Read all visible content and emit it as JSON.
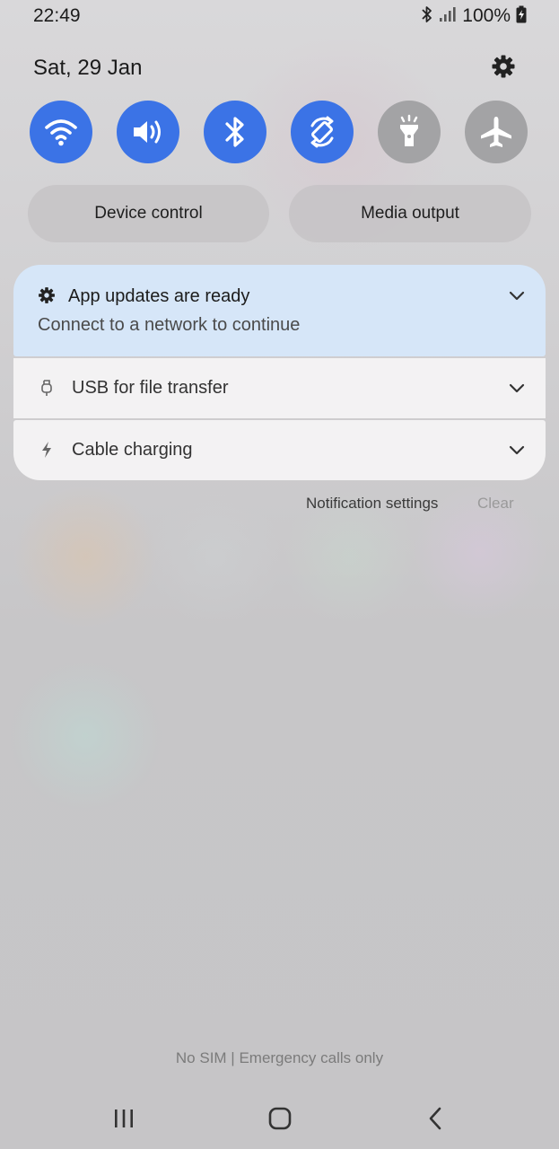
{
  "status_bar": {
    "time": "22:49",
    "battery_percent": "100%",
    "icons": [
      "bluetooth-icon",
      "signal-icon",
      "battery-charging-icon"
    ]
  },
  "panel": {
    "date": "Sat, 29 Jan",
    "settings_icon": "gear-icon"
  },
  "quick_settings": [
    {
      "name": "wifi",
      "icon": "wifi-icon",
      "state": "on"
    },
    {
      "name": "sound",
      "icon": "volume-icon",
      "state": "on"
    },
    {
      "name": "bluetooth",
      "icon": "bluetooth-icon",
      "state": "on"
    },
    {
      "name": "auto-rotate",
      "icon": "rotate-icon",
      "state": "on"
    },
    {
      "name": "flashlight",
      "icon": "flashlight-icon",
      "state": "off"
    },
    {
      "name": "airplane-mode",
      "icon": "airplane-icon",
      "state": "off"
    }
  ],
  "buttons": {
    "device_control": "Device control",
    "media_output": "Media output"
  },
  "notifications": {
    "app_updates": {
      "title": "App updates are ready",
      "body": "Connect to a network to continue",
      "icon": "gear-icon"
    },
    "usb": {
      "title": "USB for file transfer",
      "icon": "usb-icon"
    },
    "charging": {
      "title": "Cable charging",
      "icon": "bolt-icon"
    },
    "settings_label": "Notification settings",
    "clear_label": "Clear"
  },
  "carrier_text": "No SIM | Emergency calls only",
  "colors": {
    "toggle_on": "#3b73e6",
    "toggle_off": "#a3a3a5",
    "notification_highlight": "#d6e6f8"
  }
}
